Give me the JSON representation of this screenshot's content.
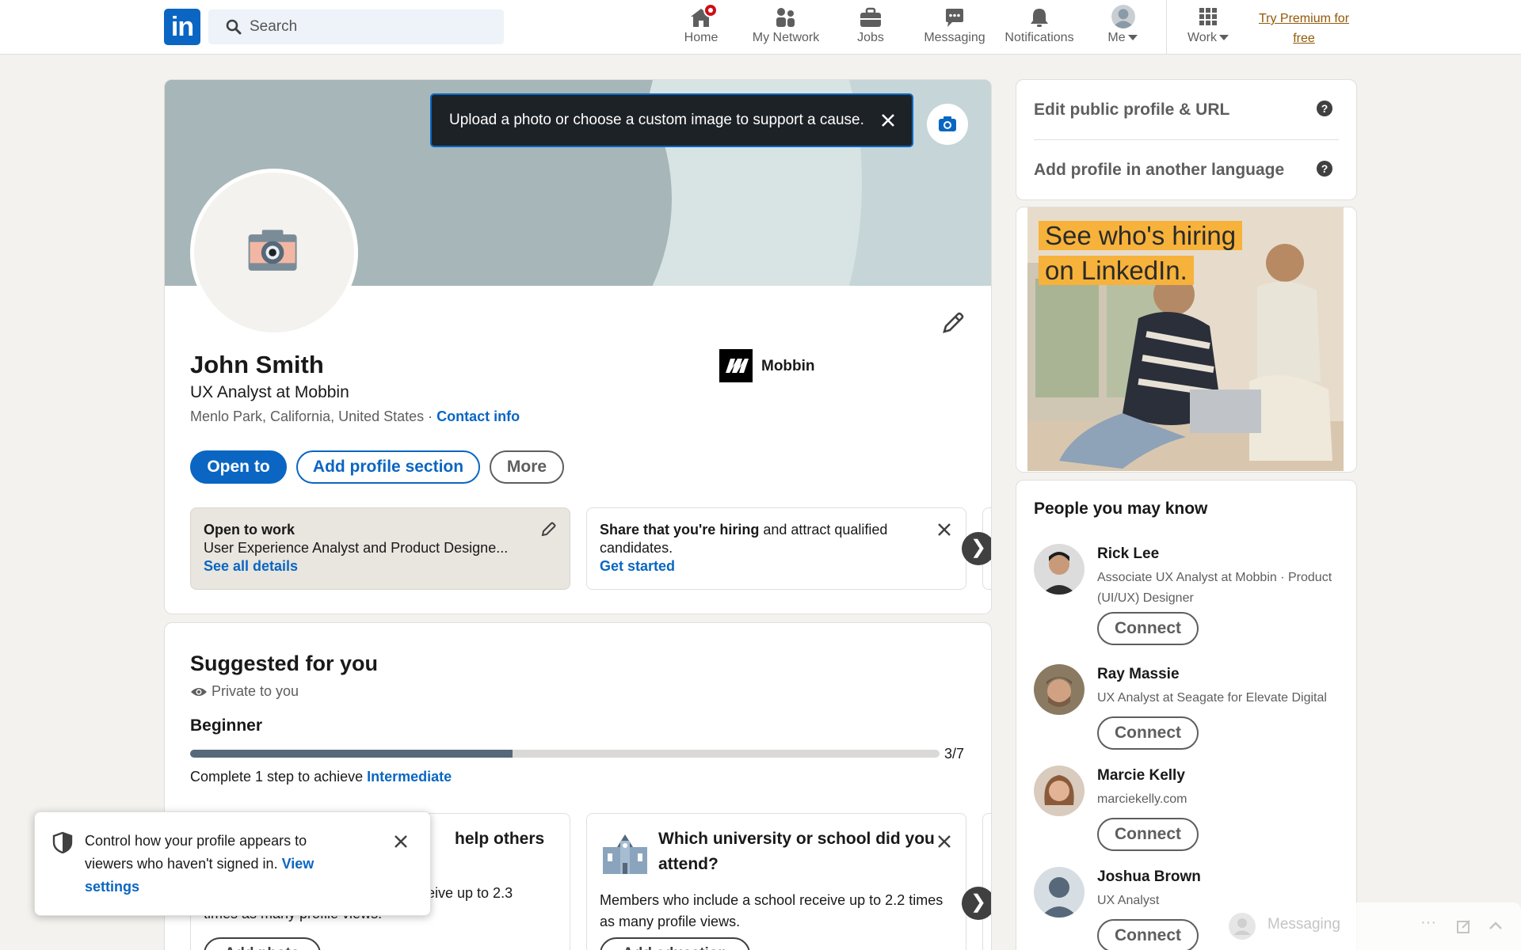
{
  "nav": {
    "search_placeholder": "Search",
    "items": [
      {
        "label": "Home",
        "icon": "home-icon"
      },
      {
        "label": "My Network",
        "icon": "network-icon"
      },
      {
        "label": "Jobs",
        "icon": "briefcase-icon"
      },
      {
        "label": "Messaging",
        "icon": "messaging-icon"
      },
      {
        "label": "Notifications",
        "icon": "bell-icon"
      },
      {
        "label": "Me",
        "icon": "avatar-icon"
      },
      {
        "label": "Work",
        "icon": "grid-icon"
      }
    ],
    "premium_line1": "Try Premium for",
    "premium_line2": "free"
  },
  "profile": {
    "tooltip": "Upload a photo or choose a custom image to support a cause.",
    "name": "John Smith",
    "headline": "UX Analyst at Mobbin",
    "location": "Menlo Park, California, United States · ",
    "contact_info": "Contact info",
    "company": "Mobbin",
    "buttons": {
      "open_to": "Open to",
      "add_section": "Add profile section",
      "more": "More"
    },
    "open_to_work": {
      "title": "Open to work",
      "desc": "User Experience Analyst and Product Designe...",
      "link": "See all details"
    },
    "hiring": {
      "bold": "Share that you're hiring",
      "rest": " and attract qualified candidates.",
      "link": "Get started"
    }
  },
  "suggested": {
    "title": "Suggested for you",
    "private": "Private to you",
    "level": "Beginner",
    "progress": 0.43,
    "ratio": "3/7",
    "complete_text": "Complete 1 step to achieve ",
    "complete_link": "Intermediate",
    "card1_title_visible": "help others",
    "card1_body_visible": "eive up to 2.3",
    "card1_body_line2": "times as many profile views.",
    "card1_button": "Add photo",
    "card2_title": "Which university or school did you attend?",
    "card2_body": "Members who include a school receive up to 2.2 times as many profile views.",
    "card2_button": "Add education"
  },
  "right": {
    "edit_public": "Edit public profile & URL",
    "add_language": "Add profile in another language",
    "ad_line1": "See who's hiring",
    "ad_line2": "on LinkedIn.",
    "pymk_title": "People you may know",
    "connect_label": "Connect",
    "people": [
      {
        "name": "Rick Lee",
        "desc": "Associate UX Analyst at Mobbin · Product (UI/UX) Designer"
      },
      {
        "name": "Ray Massie",
        "desc": "UX Analyst at Seagate for Elevate Digital"
      },
      {
        "name": "Marcie Kelly",
        "desc": "marciekelly.com"
      },
      {
        "name": "Joshua Brown",
        "desc": "UX Analyst"
      }
    ]
  },
  "toast": {
    "text": "Control how your profile appears to viewers who haven't signed in. ",
    "link": "View settings"
  },
  "messaging": {
    "label": "Messaging"
  },
  "colors": {
    "brand": "#0a66c2",
    "premium": "#915907",
    "badge": "#cc1016"
  }
}
